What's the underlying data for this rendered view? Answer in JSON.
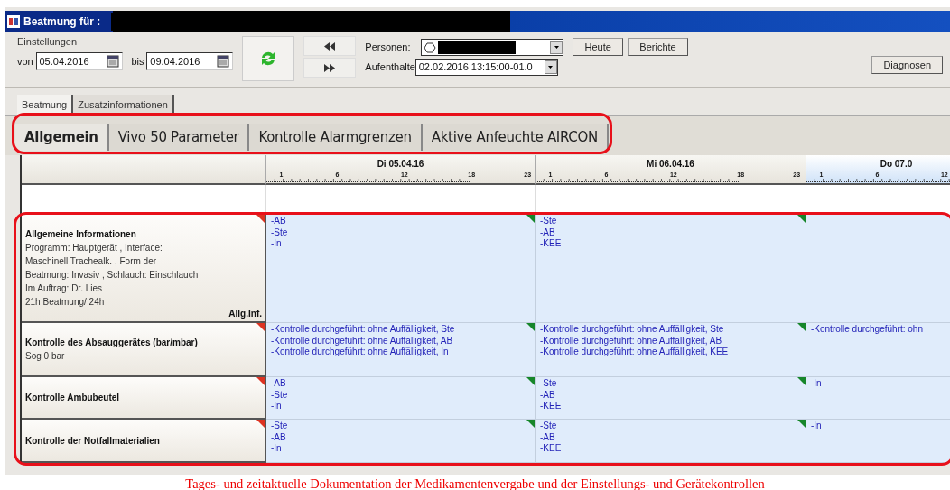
{
  "window": {
    "title": "Beatmung für :"
  },
  "settings": {
    "legend": "Einstellungen",
    "from_label": "von",
    "from_value": "05.04.2016",
    "to_label": "bis",
    "to_value": "09.04.2016",
    "persons_label": "Personen:",
    "stays_label": "Aufenthalte",
    "stays_value": "02.02.2016 13:15:00-01.0"
  },
  "buttons": [
    {
      "kind": "heute",
      "label": "Heute"
    },
    {
      "kind": "berichte",
      "label": "Berichte"
    },
    {
      "kind": "diagnosen",
      "label": "Diagnosen"
    }
  ],
  "tabs": [
    {
      "label": "Beatmung",
      "selected": true
    },
    {
      "label": "Zusatzinformationen",
      "selected": false
    }
  ],
  "subtabs": [
    {
      "label": "Allgemein",
      "selected": true
    },
    {
      "label": "Vivo 50 Parameter",
      "selected": false
    },
    {
      "label": "Kontrolle Alarmgrenzen",
      "selected": false
    },
    {
      "label": "Aktive Anfeuchte AIRCON",
      "selected": false
    }
  ],
  "days": [
    {
      "label": "Di 05.04.16",
      "highlighted": false,
      "ticks": [
        "1",
        "6",
        "12",
        "18",
        "23"
      ]
    },
    {
      "label": "Mi 06.04.16",
      "highlighted": false,
      "ticks": [
        "1",
        "6",
        "12",
        "18",
        "23"
      ]
    },
    {
      "label": "Do 07.0",
      "highlighted": true,
      "ticks": [
        "1",
        "6",
        "12"
      ]
    }
  ],
  "rows": [
    {
      "title": "Allgemeine Informationen",
      "details": [
        "Programm:  Hauptgerät , Interface:",
        "Maschinell  Trachealk. , Form  der",
        "Beatmung:  Invasiv , Schlauch:  Einschlauch",
        "Im Auftrag: Dr. Lies",
        "21h Beatmung/ 24h"
      ],
      "footer": "Allg.Inf.",
      "cells": [
        {
          "flag": true,
          "lines": [
            "-AB",
            "-Ste",
            "-In"
          ]
        },
        {
          "flag": true,
          "lines": [
            "-Ste",
            "-AB",
            "-KEE"
          ]
        },
        {}
      ]
    },
    {
      "title": "Kontrolle des Absauggerätes (bar/mbar)",
      "details": [
        "Sog  0  bar"
      ],
      "cells": [
        {
          "flag": true,
          "lines": [
            "-Kontrolle durchgeführt: ohne Auffälligkeit, Ste",
            "-Kontrolle durchgeführt: ohne Auffälligkeit, AB",
            "-Kontrolle durchgeführt: ohne Auffälligkeit, In"
          ]
        },
        {
          "flag": true,
          "lines": [
            "-Kontrolle durchgeführt: ohne Auffälligkeit, Ste",
            "-Kontrolle durchgeführt: ohne Auffälligkeit, AB",
            "-Kontrolle durchgeführt: ohne Auffälligkeit, KEE"
          ]
        },
        {
          "lines": [
            "-Kontrolle durchgeführt: ohn"
          ]
        }
      ]
    },
    {
      "title": "Kontrolle Ambubeutel",
      "details": [],
      "cells": [
        {
          "flag": true,
          "lines": [
            "-AB",
            "-Ste",
            "-In"
          ]
        },
        {
          "flag": true,
          "lines": [
            "-Ste",
            "-AB",
            "-KEE"
          ]
        },
        {
          "lines": [
            "-In"
          ]
        }
      ]
    },
    {
      "title": "Kontrolle der Notfallmaterialien",
      "details": [],
      "cells": [
        {
          "flag": true,
          "lines": [
            "-Ste",
            "-AB",
            "-In"
          ]
        },
        {
          "flag": true,
          "lines": [
            "-Ste",
            "-AB",
            "-KEE"
          ]
        },
        {
          "lines": [
            "-In"
          ]
        }
      ]
    }
  ],
  "caption": "Tages- und zeitaktuelle Dokumentation der Medikamentenvergabe und der Einstellungs- und Gerätekontrollen"
}
